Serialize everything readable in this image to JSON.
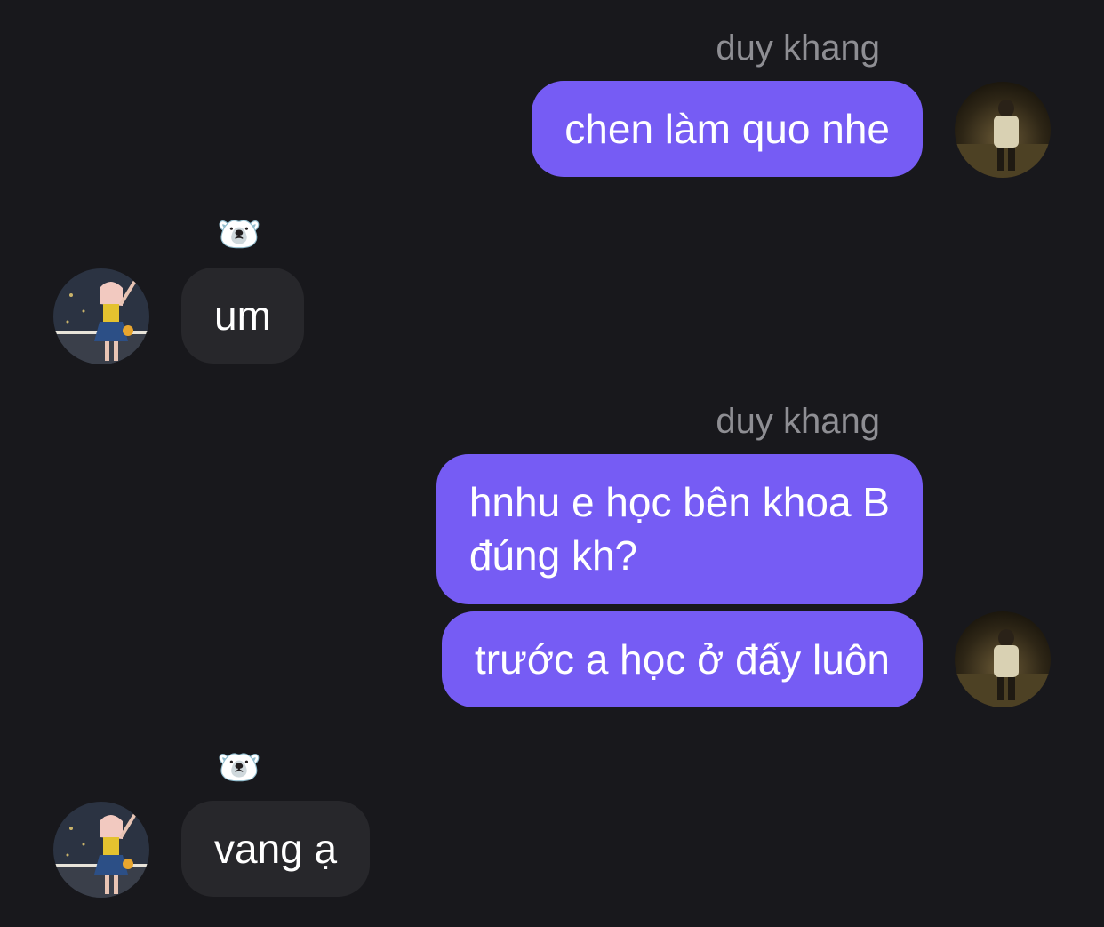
{
  "thread": {
    "messages": [
      {
        "side": "out",
        "sender": "duy khang",
        "text": "chen làm quo nhe"
      },
      {
        "side": "in",
        "sender": "🐻‍❄️",
        "text": "um"
      },
      {
        "side": "out",
        "sender": "duy khang",
        "text_lines": [
          "hnhu e học bên khoa B",
          "đúng kh?"
        ]
      },
      {
        "side": "out",
        "text": "trước a học ở đấy luôn"
      },
      {
        "side": "in",
        "sender": "🐻‍❄️",
        "text": "vang ạ"
      }
    ]
  },
  "colors": {
    "background": "#18181c",
    "outgoing_bubble": "#765cf4",
    "incoming_bubble": "#27272b",
    "sender_name": "#8e8e93"
  },
  "icons": {
    "sender_avatar": "dark-night-photo-avatar",
    "receiver_avatar": "girl-photo-avatar",
    "receiver_name": "polar-bear-emoji"
  }
}
